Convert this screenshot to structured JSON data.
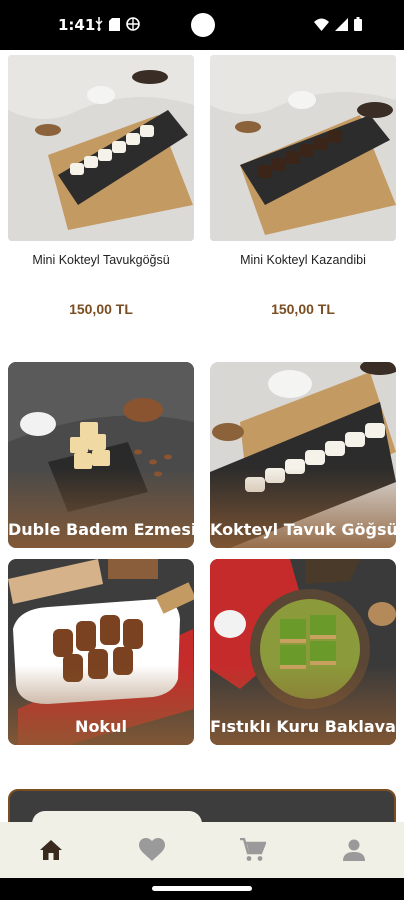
{
  "status_bar": {
    "time": "1:41",
    "icons": [
      "usb-icon",
      "sd-card-icon",
      "vpn-icon",
      "wifi-icon",
      "signal-icon",
      "battery-icon"
    ]
  },
  "products": [
    {
      "name": "Mini Kokteyl Tavukgöğsü",
      "price": "150,00 TL"
    },
    {
      "name": "Mini Kokteyl Kazandibi",
      "price": "150,00 TL"
    }
  ],
  "categories": [
    {
      "label": "Duble Badem Ezmesi"
    },
    {
      "label": "Kokteyl Tavuk Göğsü"
    },
    {
      "label": "Nokul"
    },
    {
      "label": "Fıstıklı Kuru Baklava"
    }
  ],
  "bottom_nav": {
    "items": [
      {
        "icon": "home-icon",
        "active": true
      },
      {
        "icon": "heart-icon",
        "active": false
      },
      {
        "icon": "cart-icon",
        "active": false
      },
      {
        "icon": "profile-icon",
        "active": false
      }
    ]
  },
  "colors": {
    "price": "#7a4e22",
    "nav_bg": "#f1f0e7",
    "nav_active": "#3a2a1e",
    "nav_inactive": "#9a9a9a",
    "tile_gradient": "#8c5c34"
  }
}
